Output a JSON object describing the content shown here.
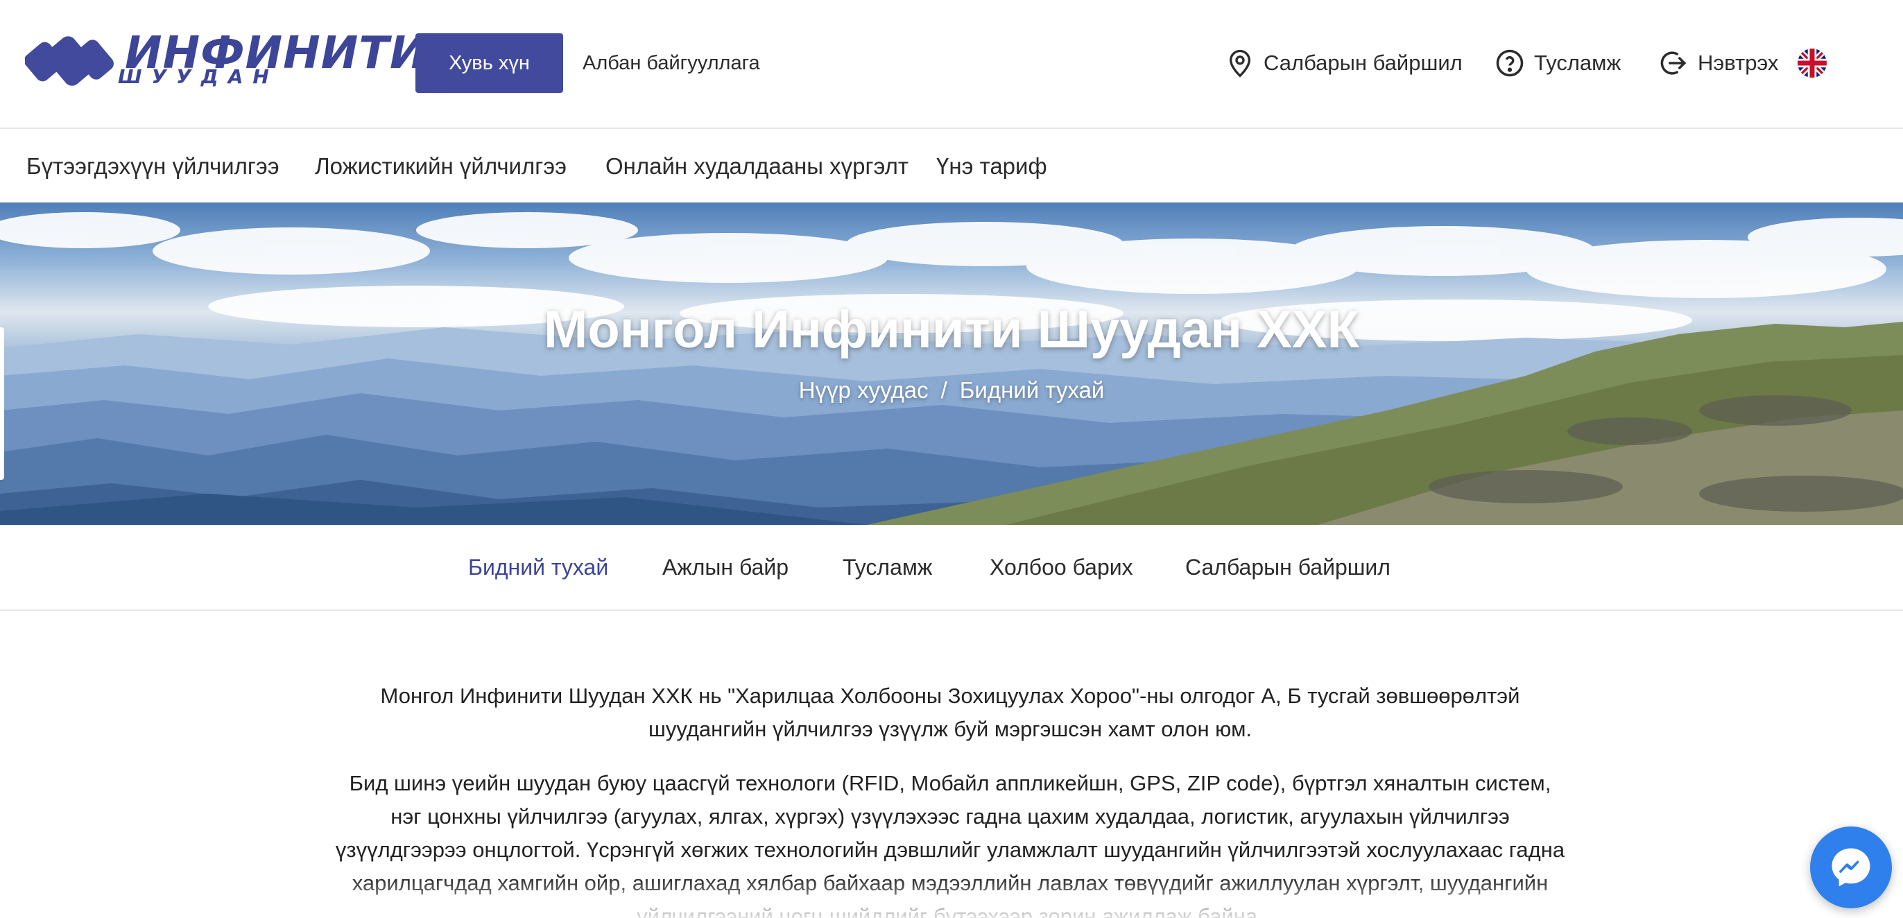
{
  "logo": {
    "title": "ИНФИНИТИ",
    "subtitle": "ШУУДАН"
  },
  "header": {
    "personal_label": "Хувь хүн",
    "business_label": "Албан байгууллага",
    "branch_label": "Салбарын байршил",
    "help_label": "Тусламж",
    "login_label": "Нэвтрэх",
    "language_icon": "uk-flag-icon"
  },
  "service_nav": {
    "items": [
      {
        "label": "Бүтээгдэхүүн үйлчилгээ"
      },
      {
        "label": "Ложистикийн үйлчилгээ"
      },
      {
        "label": "Онлайн худалдааны хүргэлт"
      },
      {
        "label": "Үнэ тариф"
      }
    ]
  },
  "hero": {
    "title": "Монгол Инфинити Шуудан ХХК",
    "breadcrumb": {
      "home": "Нүүр хуудас",
      "separator": "/",
      "current": "Бидний тухай"
    }
  },
  "sub_nav": {
    "items": [
      {
        "label": "Бидний тухай",
        "active": true
      },
      {
        "label": "Ажлын байр",
        "active": false
      },
      {
        "label": "Тусламж",
        "active": false
      },
      {
        "label": "Холбоо барих",
        "active": false
      },
      {
        "label": "Салбарын байршил",
        "active": false
      }
    ]
  },
  "content": {
    "paragraphs": [
      "Монгол Инфинити Шуудан ХХК нь \"Харилцаа Холбооны Зохицуулах Хороо\"-ны олгодог А, Б тусгай зөвшөөрөлтэй шуудангийн үйлчилгээ үзүүлж буй мэргэшсэн хамт олон юм.",
      "Бид шинэ үеийн шуудан буюу цаасгүй технологи (RFID, Мобайл аппликейшн, GPS, ZIP code), бүртгэл хяналтын систем, нэг цонхны үйлчилгээ (агуулах, ялгах, хүргэх) үзүүлэхээс гадна цахим худалдаа, логистик, агуулахын үйлчилгээ үзүүлдгээрээ онцлогтой. Үсрэнгүй хөгжих технологийн дэвшлийг уламжлалт шуудангийн үйлчилгээтэй хослуулахаас гадна харилцагчдад хамгийн ойр, ашиглахад хялбар байхаар мэдээллийн лавлах төвүүдийг ажиллуулан хүргэлт, шуудангийн үйлчилгээний цогц шийдлийг бүтээхээр зорин ажиллаж байна."
    ]
  },
  "colors": {
    "brand": "#424a9d",
    "brand_text": "#3d4599",
    "messenger": "#2f80ed"
  },
  "icons": {
    "branch": "location-pin-icon",
    "help": "question-circle-icon",
    "login": "login-arrow-icon",
    "chat": "messenger-icon"
  }
}
